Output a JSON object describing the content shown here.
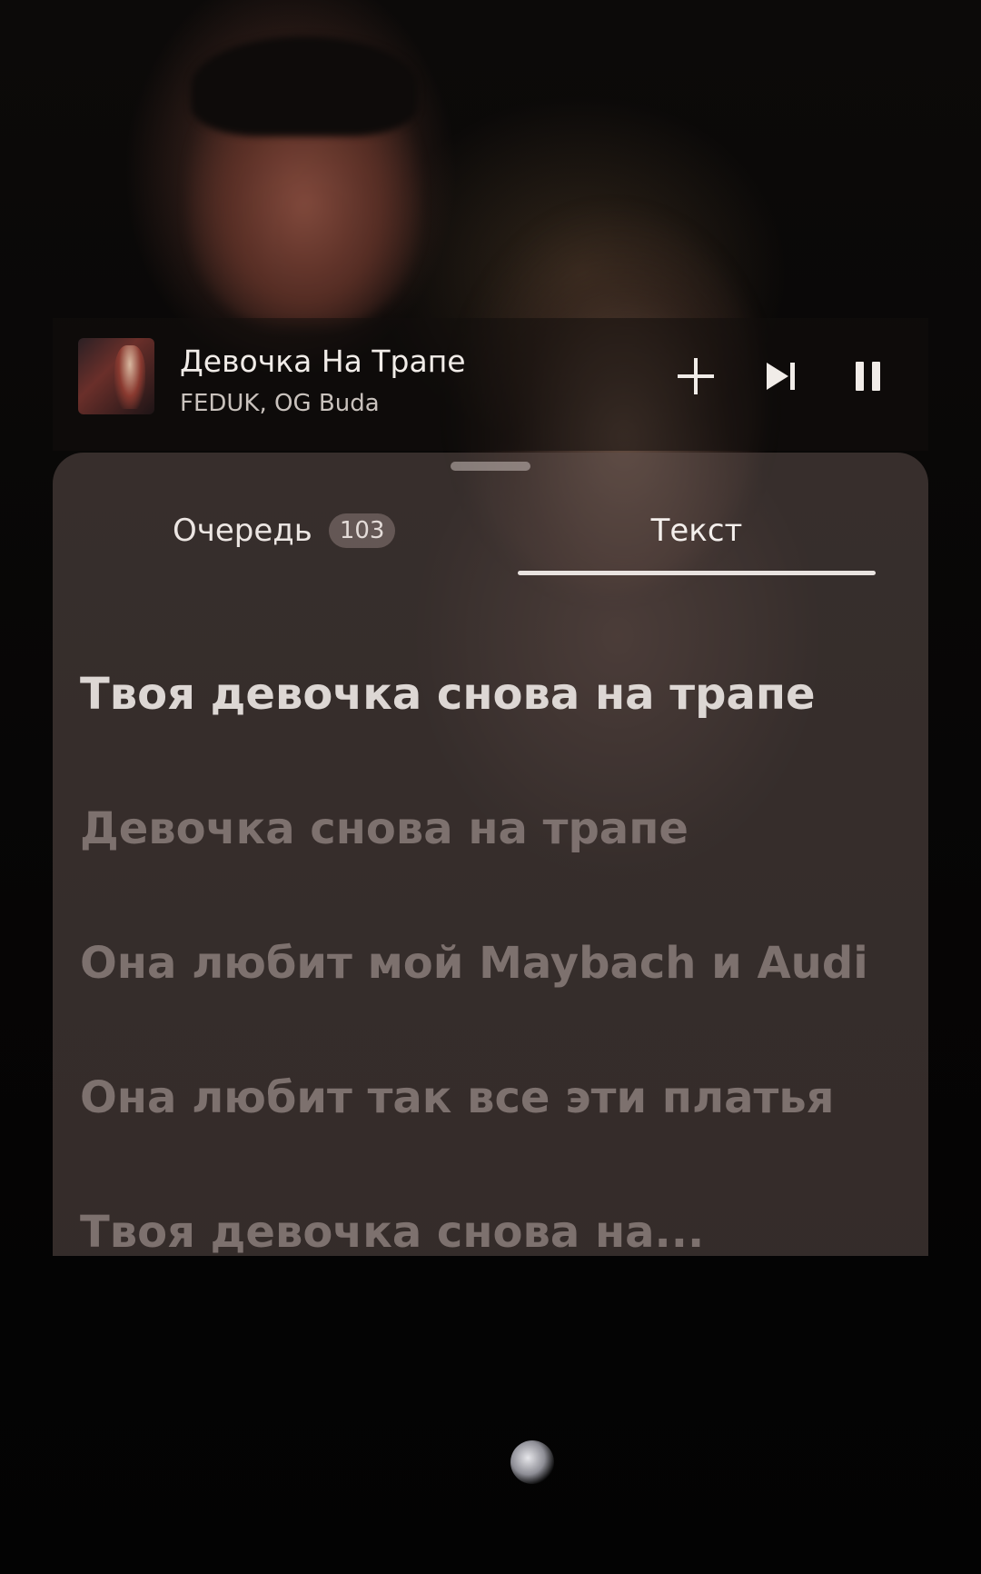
{
  "mini_player": {
    "title": "Девочка На Трапе",
    "artists": "FEDUK, OG Buda",
    "icons": {
      "add": "plus-icon",
      "next": "skip-next-icon",
      "pause": "pause-icon"
    }
  },
  "tabs": {
    "queue_label": "Очередь",
    "queue_count": "103",
    "lyrics_label": "Текст",
    "active": "lyrics"
  },
  "lyrics": [
    {
      "text": "Твоя девочка снова на трапе",
      "state": "active"
    },
    {
      "text": "Девочка снова на трапе",
      "state": "upcoming"
    },
    {
      "text": "Она любит мой Maybach и Audi",
      "state": "upcoming"
    },
    {
      "text": "Она любит так все эти платья",
      "state": "upcoming"
    },
    {
      "text": "Твоя девочка снова на...",
      "state": "upcoming"
    }
  ],
  "colors": {
    "sheet": "#5c4e4a",
    "active_lyric": "#ddd7d4",
    "upcoming_lyric": "#968886"
  }
}
